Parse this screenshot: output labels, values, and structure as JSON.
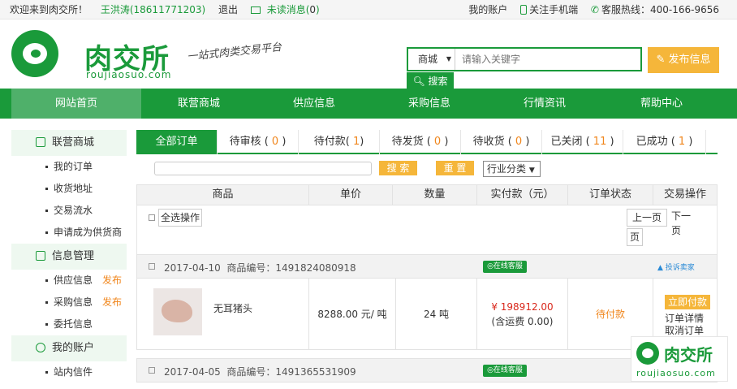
{
  "topbar": {
    "welcome": "欢迎来到肉交所！",
    "user": "王洪涛(18611771203)",
    "logout": "退出",
    "unread_label": "未读消息(",
    "unread_count": "0",
    "unread_close": ")",
    "my_account": "我的账户",
    "follow_mobile": "关注手机端",
    "hotline": "客服热线：400-166-9656"
  },
  "header": {
    "brand": "肉交所",
    "brand_url": "roujiaosuo.com",
    "slogan": "一站式肉类交易平台",
    "search_scope": "商城",
    "search_placeholder": "请输入关键字",
    "search_button": "搜索",
    "publish_button": "发布信息"
  },
  "nav": [
    "网站首页",
    "联营商城",
    "供应信息",
    "采购信息",
    "行情资讯",
    "帮助中心"
  ],
  "sidebar": {
    "sections": [
      {
        "title": "联营商城",
        "items": [
          {
            "label": "我的订单"
          },
          {
            "label": "收货地址"
          },
          {
            "label": "交易流水"
          },
          {
            "label": "申请成为供货商"
          }
        ]
      },
      {
        "title": "信息管理",
        "items": [
          {
            "label": "供应信息",
            "tag": "发布"
          },
          {
            "label": "采购信息",
            "tag": "发布"
          },
          {
            "label": "委托信息"
          }
        ]
      },
      {
        "title": "我的账户",
        "items": [
          {
            "label": "站内信件"
          }
        ]
      }
    ]
  },
  "tabs": [
    {
      "label": "全部订单"
    },
    {
      "label": "待审核",
      "count": "0"
    },
    {
      "label": "待付款",
      "count": "1"
    },
    {
      "label": "待发货",
      "count": "0"
    },
    {
      "label": "待收货",
      "count": "0"
    },
    {
      "label": "已关闭",
      "count": "11"
    },
    {
      "label": "已成功",
      "count": "1"
    }
  ],
  "toolbar": {
    "search_button": "搜 索",
    "reset_button": "重 置",
    "category": "行业分类"
  },
  "columns": [
    "商品",
    "单价",
    "数量",
    "实付款（元）",
    "订单状态",
    "交易操作"
  ],
  "select_all": "全选操作",
  "pagination": {
    "prev": "上一页",
    "next": "下一页"
  },
  "order_no_label": "商品编号：",
  "online_service": "在线客服",
  "complain": "投诉卖家",
  "orders": [
    {
      "date": "2017-04-10",
      "order_no": "1491824080918",
      "product": "无耳猪头",
      "unit_price": "8288.00 元/ 吨",
      "quantity": "24 吨",
      "paid": "¥ 198912.00",
      "shipping": "(含运费 0.00)",
      "status": "待付款",
      "actions": [
        "立即付款",
        "订单详情",
        "取消订单"
      ]
    },
    {
      "date": "2017-04-05",
      "order_no": "1491365531909"
    }
  ],
  "watermark": {
    "brand": "肉交所",
    "url": "roujiaosuo.com"
  }
}
